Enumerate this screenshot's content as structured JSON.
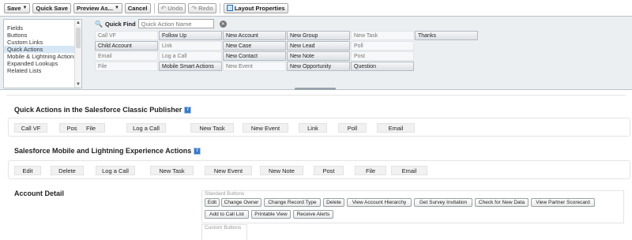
{
  "toolbar": {
    "save": "Save",
    "quick_save": "Quick Save",
    "preview_as": "Preview As...",
    "cancel": "Cancel",
    "undo": "Undo",
    "redo": "Redo",
    "layout_properties": "Layout Properties"
  },
  "palette": {
    "categories": [
      "Fields",
      "Buttons",
      "Custom Links",
      "Quick Actions",
      "Mobile & Lightning Actions",
      "Expanded Lookups",
      "Related Lists"
    ],
    "selected_category": "Quick Actions",
    "quick_find_label": "Quick Find",
    "quick_find_placeholder": "Quick Action Name",
    "items": [
      [
        "Call VF",
        "Follow Up",
        "New Account",
        "New Group",
        "New Task",
        "Thanks"
      ],
      [
        "Child Account",
        "Link",
        "New Case",
        "New Lead",
        "Poll",
        ""
      ],
      [
        "Email",
        "Log a Call",
        "New Contact",
        "New Note",
        "Post",
        ""
      ],
      [
        "File",
        "Mobile Smart Actions",
        "New Event",
        "New Opportunity",
        "Question",
        ""
      ]
    ]
  },
  "sections": {
    "classic_title": "Quick Actions in the Salesforce Classic Publisher",
    "classic_actions": [
      "Call VF",
      "Post",
      "File",
      "Log a Call",
      "New Task",
      "New Event",
      "Link",
      "Poll",
      "Email"
    ],
    "mobile_title": "Salesforce Mobile and Lightning Experience Actions",
    "mobile_actions": [
      "Edit",
      "Delete",
      "Log a Call",
      "New Task",
      "New Event",
      "New Note",
      "Post",
      "File",
      "Email"
    ],
    "detail_title": "Account Detail",
    "standard_buttons_label": "Standard Buttons",
    "standard_buttons": [
      "Edit",
      "Change Owner",
      "Change Record Type",
      "Delete",
      "View Account Hierarchy",
      "Get Survey Invitation",
      "Check for New Data",
      "View Partner Scorecard",
      "Add to Call List",
      "Printable View",
      "Receive Alerts"
    ],
    "custom_buttons_label": "Custom Buttons"
  }
}
